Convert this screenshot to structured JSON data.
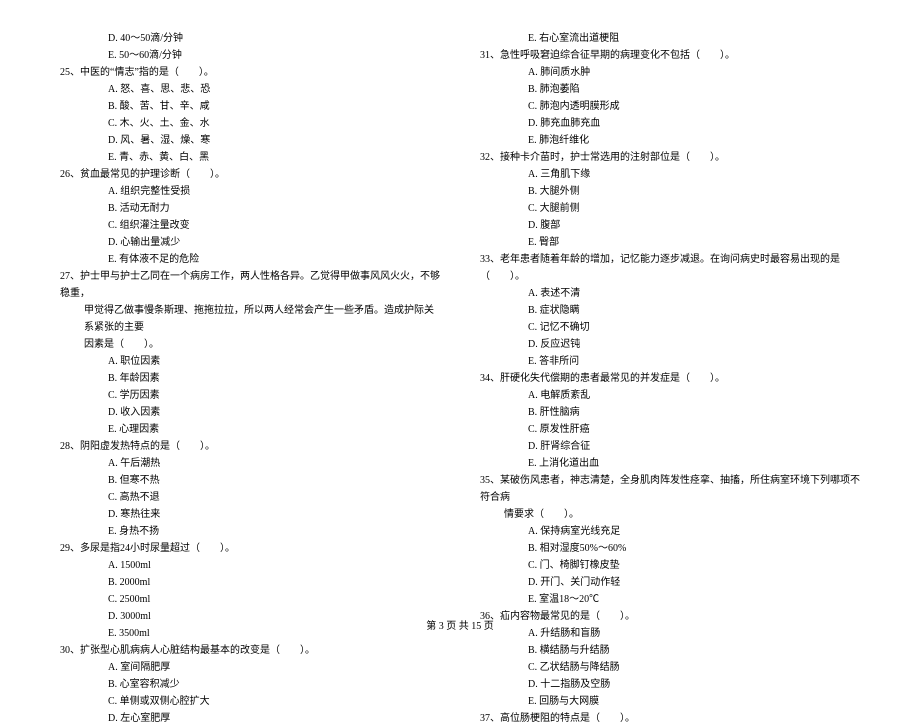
{
  "footer": "第 3 页 共 15 页",
  "left": {
    "q24opts": [
      "D. 40～50滴/分钟",
      "E. 50～60滴/分钟"
    ],
    "q25": "25、中医的“情志”指的是（　　）。",
    "q25opts": [
      "A. 怒、喜、思、悲、恐",
      "B. 酸、苦、甘、辛、咸",
      "C. 木、火、土、金、水",
      "D. 风、暑、湿、燥、寒",
      "E. 青、赤、黄、白、黑"
    ],
    "q26": "26、贫血最常见的护理诊断（　　）。",
    "q26opts": [
      "A. 组织完整性受损",
      "B. 活动无耐力",
      "C. 组织灌注量改变",
      "D. 心输出量减少",
      "E. 有体液不足的危险"
    ],
    "q27a": "27、护士甲与护士乙同在一个病房工作，两人性格各异。乙觉得甲做事风风火火，不够稳重，",
    "q27b": "甲觉得乙做事慢条斯理、拖拖拉拉，所以两人经常会产生一些矛盾。造成护际关系紧张的主要",
    "q27c": "因素是（　　）。",
    "q27opts": [
      "A. 职位因素",
      "B. 年龄因素",
      "C. 学历因素",
      "D. 收入因素",
      "E. 心理因素"
    ],
    "q28": "28、阴阳虚发热特点的是（　　）。",
    "q28opts": [
      "A. 午后潮热",
      "B. 但寒不热",
      "C. 高热不退",
      "D. 寒热往来",
      "E. 身热不扬"
    ],
    "q29": "29、多尿是指24小时尿量超过（　　）。",
    "q29opts": [
      "A. 1500ml",
      "B. 2000ml",
      "C. 2500ml",
      "D. 3000ml",
      "E. 3500ml"
    ],
    "q30": "30、扩张型心肌病病人心脏结构最基本的改变是（　　）。",
    "q30opts": [
      "A. 室间隔肥厚",
      "B. 心室容积减少",
      "C. 单侧或双侧心腔扩大",
      "D. 左心室肥厚"
    ]
  },
  "right": {
    "q30e": "E. 右心室流出道梗阻",
    "q31": "31、急性呼吸窘迫综合征早期的病理变化不包括（　　）。",
    "q31opts": [
      "A. 肺间质水肿",
      "B. 肺泡萎陷",
      "C. 肺泡内透明膜形成",
      "D. 肺充血肺充血",
      "E. 肺泡纤维化"
    ],
    "q32": "32、接种卡介苗时，护士常选用的注射部位是（　　）。",
    "q32opts": [
      "A. 三角肌下缘",
      "B. 大腿外侧",
      "C. 大腿前侧",
      "D. 腹部",
      "E. 臀部"
    ],
    "q33": "33、老年患者随着年龄的增加，记忆能力逐步减退。在询问病史时最容易出现的是（　　）。",
    "q33opts": [
      "A. 表述不清",
      "B. 症状隐瞒",
      "C. 记忆不确切",
      "D. 反应迟钝",
      "E. 答非所问"
    ],
    "q34": "34、肝硬化失代偿期的患者最常见的并发症是（　　）。",
    "q34opts": [
      "A. 电解质紊乱",
      "B. 肝性脑病",
      "C. 原发性肝癌",
      "D. 肝肾综合征",
      "E. 上消化道出血"
    ],
    "q35a": "35、某破伤风患者，神志清楚，全身肌肉阵发性痉挛、抽搐，所住病室环境下列哪项不符合病",
    "q35b": "情要求（　　）。",
    "q35opts": [
      "A. 保持病室光线充足",
      "B. 相对湿度50%～60%",
      "C. 门、椅脚钉橡皮垫",
      "D. 开门、关门动作轻",
      "E. 室温18～20℃"
    ],
    "q36": "36、疝内容物最常见的是（　　）。",
    "q36opts": [
      "A. 升结肠和盲肠",
      "B. 横结肠与升结肠",
      "C. 乙状结肠与降结肠",
      "D. 十二指肠及空肠",
      "E. 回肠与大网膜"
    ],
    "q37": "37、高位肠梗阻的特点是（　　）。"
  }
}
